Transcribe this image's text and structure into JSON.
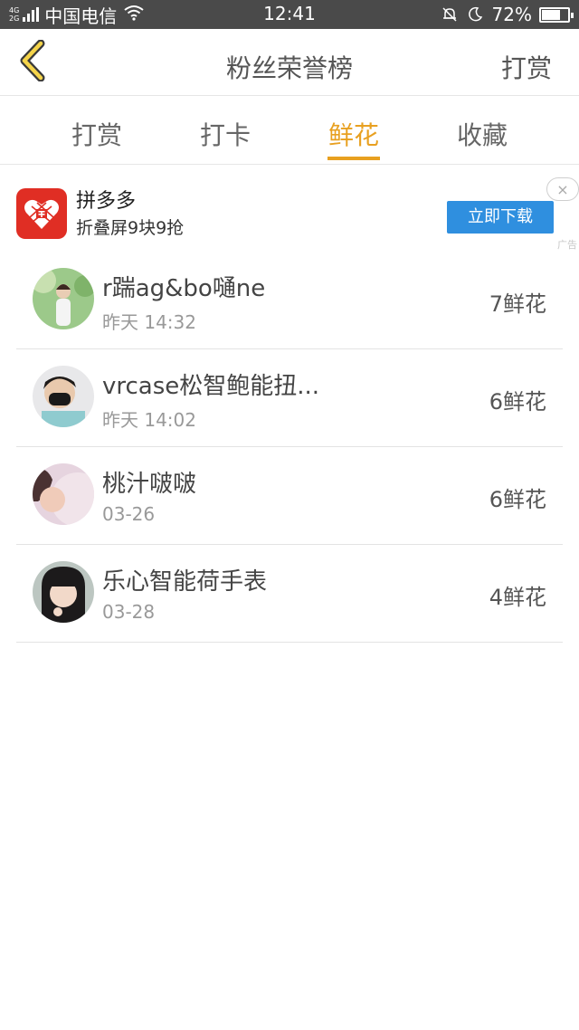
{
  "status_bar": {
    "network_top": "4G",
    "network_bottom": "2G",
    "carrier": "中国电信",
    "time": "12:41",
    "battery": "72%",
    "battery_level": 0.72
  },
  "header": {
    "title": "粉丝荣誉榜",
    "action_label": "打赏"
  },
  "tabs": [
    {
      "label": "打赏",
      "active": false
    },
    {
      "label": "打卡",
      "active": false
    },
    {
      "label": "鲜花",
      "active": true
    },
    {
      "label": "收藏",
      "active": false
    }
  ],
  "ad": {
    "title": "拼多多",
    "subtitle": "折叠屏9块9抢",
    "download_label": "立即下载",
    "close_label": "×",
    "tag": "广告"
  },
  "fans": [
    {
      "name": "r踹ag&bo嗵ne",
      "time": "昨天 14:32",
      "count": "7鲜花"
    },
    {
      "name": "vrcase松智鲍能扭...",
      "time": "昨天 14:02",
      "count": "6鲜花"
    },
    {
      "name": "桃汁啵啵",
      "time": "03-26",
      "count": "6鲜花"
    },
    {
      "name": "乐心智能荷手表",
      "time": "03-28",
      "count": "4鲜花"
    }
  ],
  "colors": {
    "accent": "#e8a020",
    "status_bar_bg": "#4a4a4a",
    "ad_button": "#2f8fdf",
    "ad_logo": "#e02e24"
  }
}
